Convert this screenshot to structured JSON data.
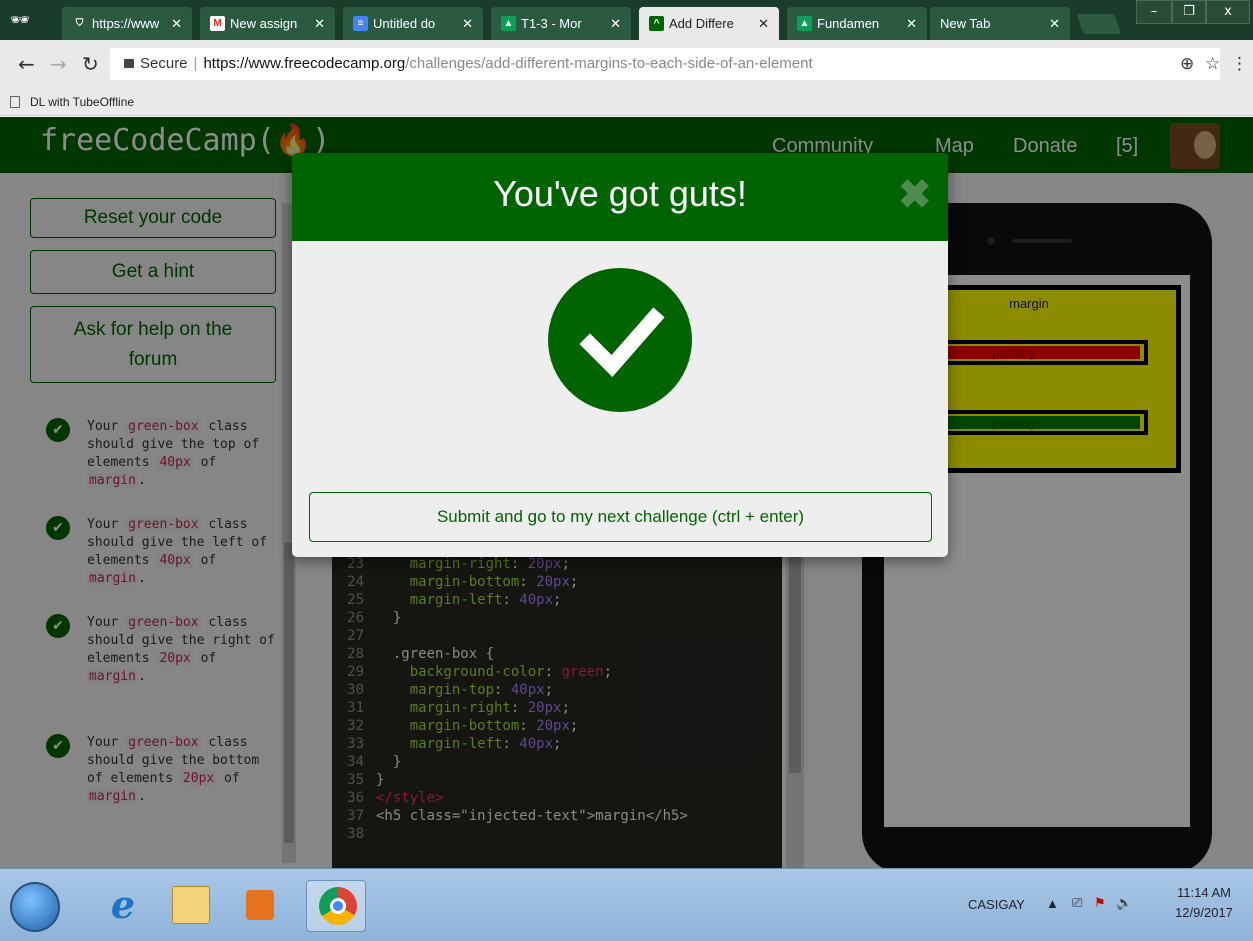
{
  "browser": {
    "tabs": [
      {
        "title": "https://www",
        "icon": "shield-icon"
      },
      {
        "title": "New assign",
        "icon": "gmail-icon"
      },
      {
        "title": "Untitled do",
        "icon": "docs-icon"
      },
      {
        "title": "T1-3 - Mor",
        "icon": "classroom-icon"
      },
      {
        "title": "Add Differe",
        "icon": "fcc-icon"
      },
      {
        "title": "Fundamen",
        "icon": "classroom-icon"
      },
      {
        "title": "New Tab",
        "icon": "none"
      }
    ],
    "secure_label": "Secure",
    "url_host": "https://www.freecodecamp.org",
    "url_path": "/challenges/add-different-margins-to-each-side-of-an-element",
    "bookmark": "DL with TubeOffline",
    "window_controls": {
      "minimize": "–",
      "maximize": "❐",
      "close": "x"
    }
  },
  "fcc": {
    "logo": "freeCodeCamp(🔥)",
    "nav": {
      "community": "Community",
      "map": "Map",
      "donate": "Donate",
      "points": "[5]"
    }
  },
  "sidebar": {
    "reset": "Reset your code",
    "hint": "Get a hint",
    "help": "Ask for help on the forum",
    "tests": [
      {
        "pre": "Your ",
        "code1": "green-box",
        "mid": " class should give the top of elements ",
        "code2": "40px",
        "of": " of ",
        "code3": "margin",
        "post": "."
      },
      {
        "pre": "Your ",
        "code1": "green-box",
        "mid": " class should give the left of elements ",
        "code2": "40px",
        "of": " of ",
        "code3": "margin",
        "post": "."
      },
      {
        "pre": "Your ",
        "code1": "green-box",
        "mid": " class should give the right of elements ",
        "code2": "20px",
        "of": " of ",
        "code3": "margin",
        "post": "."
      },
      {
        "pre": "Your ",
        "code1": "green-box",
        "mid": " class should give the bottom of elements ",
        "code2": "20px",
        "of": " of ",
        "code3": "margin",
        "post": "."
      }
    ]
  },
  "editor": {
    "lines": [
      {
        "n": "23",
        "indent": "    ",
        "prop": "margin-right",
        "val": "20px",
        "kind": "decl"
      },
      {
        "n": "24",
        "indent": "    ",
        "prop": "margin-bottom",
        "val": "20px",
        "kind": "decl"
      },
      {
        "n": "25",
        "indent": "    ",
        "prop": "margin-left",
        "val": "40px",
        "kind": "decl"
      },
      {
        "n": "26",
        "text": "  }",
        "kind": "plain"
      },
      {
        "n": "27",
        "text": "",
        "kind": "plain"
      },
      {
        "n": "28",
        "text": "  .green-box {",
        "kind": "plain"
      },
      {
        "n": "29",
        "indent": "    ",
        "prop": "background-color",
        "val": "green",
        "kind": "kwdecl"
      },
      {
        "n": "30",
        "indent": "    ",
        "prop": "margin-top",
        "val": "40px",
        "kind": "decl"
      },
      {
        "n": "31",
        "indent": "    ",
        "prop": "margin-right",
        "val": "20px",
        "kind": "decl"
      },
      {
        "n": "32",
        "indent": "    ",
        "prop": "margin-bottom",
        "val": "20px",
        "kind": "decl"
      },
      {
        "n": "33",
        "indent": "    ",
        "prop": "margin-left",
        "val": "40px",
        "kind": "decl"
      },
      {
        "n": "34",
        "text": "  }",
        "kind": "plain"
      },
      {
        "n": "35",
        "text": "}",
        "kind": "plain"
      },
      {
        "n": "36",
        "text": "</style>",
        "kind": "tag"
      },
      {
        "n": "37",
        "text": "<h5 class=\"injected-text\">margin</h5>",
        "kind": "h5"
      },
      {
        "n": "38",
        "text": "",
        "kind": "plain"
      }
    ]
  },
  "preview": {
    "margin_label": "margin",
    "padding_red": "padding",
    "padding_green": "padding"
  },
  "modal": {
    "title": "You've got guts!",
    "close": "✖",
    "submit": "Submit and go to my next challenge (ctrl + enter)"
  },
  "taskbar": {
    "user": "CASIGAY",
    "time": "11:14 AM",
    "date": "12/9/2017"
  },
  "colors": {
    "fcc_green": "#006400",
    "preview_yellow": "#ffff00",
    "preview_red": "#ff0000",
    "preview_green": "#008000"
  }
}
